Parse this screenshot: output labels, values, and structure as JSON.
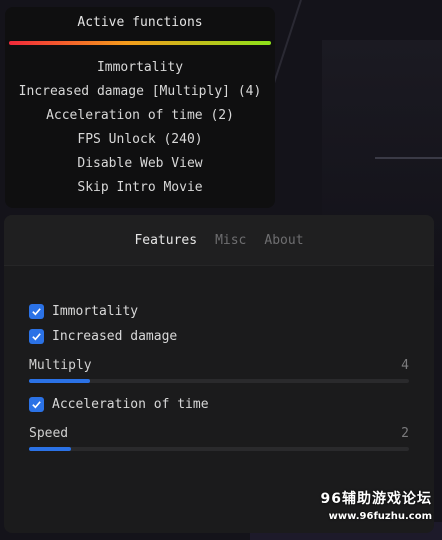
{
  "overlay": {
    "title": "Active functions",
    "items": [
      "Immortality",
      "Increased damage [Multiply] (4)",
      "Acceleration of time (2)",
      "FPS Unlock (240)",
      "Disable Web View",
      "Skip Intro Movie"
    ]
  },
  "tabs": [
    {
      "label": "Features",
      "active": true
    },
    {
      "label": "Misc",
      "active": false
    },
    {
      "label": "About",
      "active": false
    }
  ],
  "features": {
    "immortality": {
      "label": "Immortality",
      "checked": true
    },
    "increased_damage": {
      "label": "Increased damage",
      "checked": true
    },
    "multiply": {
      "label": "Multiply",
      "value": "4",
      "fraction": 0.16
    },
    "acceleration": {
      "label": "Acceleration of time",
      "checked": true
    },
    "speed": {
      "label": "Speed",
      "value": "2",
      "fraction": 0.11
    }
  },
  "watermark": {
    "line1": "96辅助游戏论坛",
    "line2": "www.96fuzhu.com"
  },
  "colors": {
    "accent": "#2b72e6",
    "gradient_start": "#f2293a",
    "gradient_mid": "#f59c1c",
    "gradient_end": "#8de21a"
  }
}
